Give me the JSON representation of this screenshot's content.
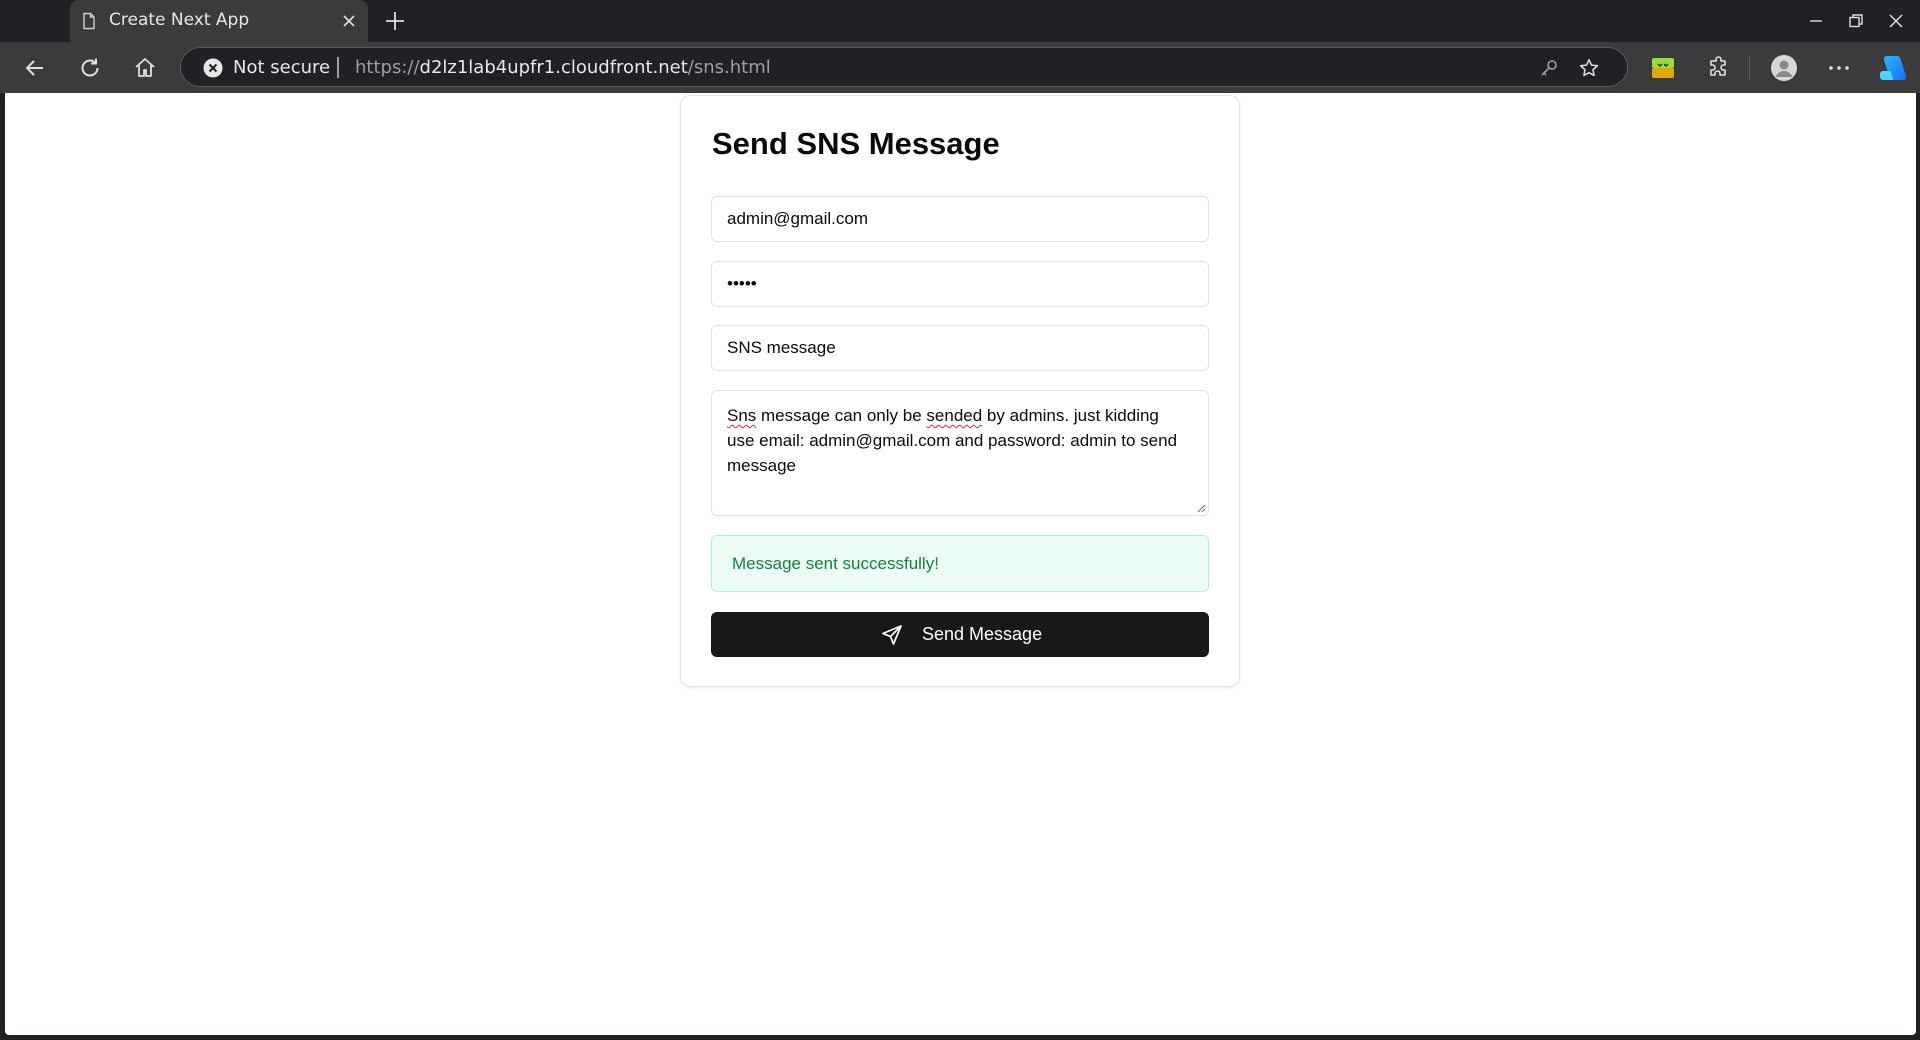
{
  "browser": {
    "tab_title": "Create Next App",
    "security_label": "Not secure",
    "url_scheme": "https://",
    "url_host": "d2lz1lab4upfr1.cloudfront.net",
    "url_path": "/sns.html"
  },
  "form": {
    "title": "Send SNS Message",
    "email_value": "admin@gmail.com",
    "password_value": "admin",
    "subject_value": "SNS message",
    "message_lines": {
      "word1": "Sns",
      "part2": " message can only be ",
      "word2": "sended",
      "part3": " by admins. just kidding",
      "line2": "use email: admin@gmail.com and password: admin to send",
      "line3": "message"
    },
    "status_message": "Message sent successfully!",
    "submit_label": "Send Message"
  },
  "colors": {
    "accent_button": "#18181b",
    "success_bg": "#ecfdf5",
    "success_text": "#15803d"
  }
}
